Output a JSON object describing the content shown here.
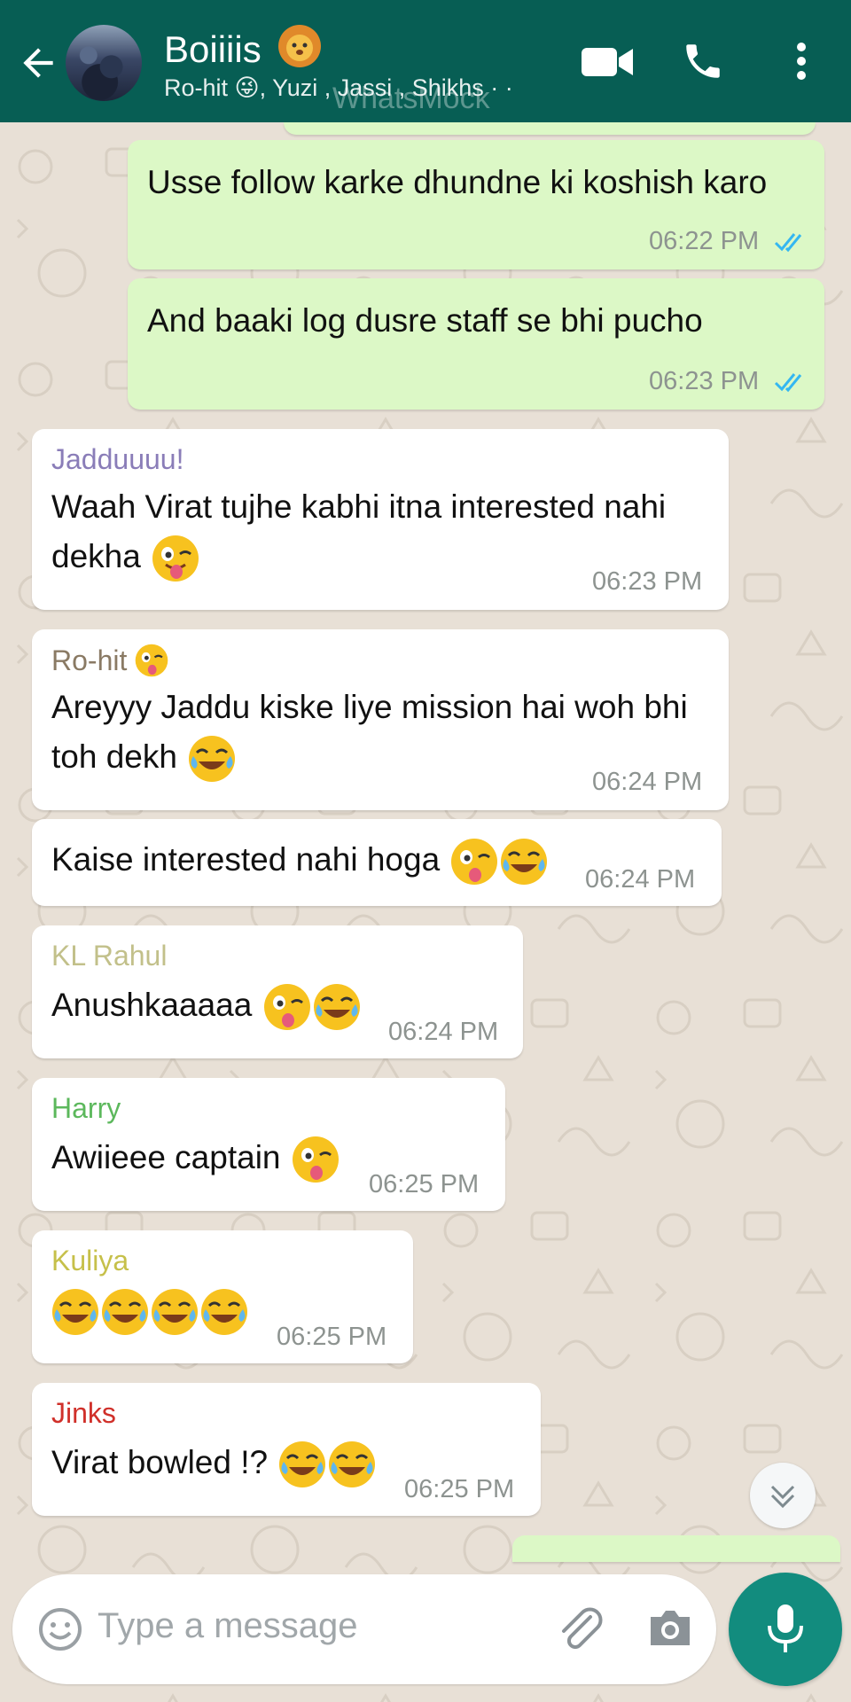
{
  "header": {
    "title": "Boiiiis",
    "subtitle": "Ro-hit 😜, Yuzi , Jassi , Shikhs · ·",
    "watermark": "WhatsMock"
  },
  "colors": {
    "header_bg": "#075e54",
    "outgoing_bubble": "#dcf8c6",
    "incoming_bubble": "#ffffff",
    "chat_bg": "#e8e0d6",
    "read_ticks": "#34b7f1",
    "fab": "#128c7e"
  },
  "messages": [
    {
      "direction": "out",
      "text": "Usse follow karke dhundne ki koshish karo",
      "time": "06:22 PM",
      "status": "read"
    },
    {
      "direction": "out",
      "text": "And baaki log dusre staff se bhi pucho",
      "time": "06:23 PM",
      "status": "read"
    },
    {
      "direction": "in",
      "sender": "Jadduuuu!",
      "sender_color": "#8a7db8",
      "line1": "Waah Virat tujhe kabhi itna interested nahi",
      "line2": "dekha",
      "emojis": [
        "winking-tongue"
      ],
      "time": "06:23 PM"
    },
    {
      "direction": "in",
      "sender": "Ro-hit",
      "sender_color": "#8a7a64",
      "sender_emoji": "winking-tongue",
      "line1": "Areyyy Jaddu kiske liye mission hai woh bhi",
      "line2": "toh dekh",
      "emojis": [
        "tears-of-joy"
      ],
      "time": "06:24 PM"
    },
    {
      "direction": "in",
      "text": "Kaise interested nahi hoga",
      "emojis": [
        "winking-tongue",
        "tears-of-joy"
      ],
      "time": "06:24 PM"
    },
    {
      "direction": "in",
      "sender": "KL Rahul",
      "sender_color": "#c2c08a",
      "text": "Anushkaaaaa",
      "emojis": [
        "winking-tongue",
        "tears-of-joy"
      ],
      "time": "06:24 PM"
    },
    {
      "direction": "in",
      "sender": "Harry",
      "sender_color": "#5cb85c",
      "text": "Awiieee captain",
      "emojis": [
        "winking-tongue"
      ],
      "time": "06:25 PM"
    },
    {
      "direction": "in",
      "sender": "Kuliya",
      "sender_color": "#c6c04a",
      "text": "",
      "emojis": [
        "tears-of-joy",
        "tears-of-joy",
        "tears-of-joy",
        "tears-of-joy"
      ],
      "time": "06:25 PM"
    },
    {
      "direction": "in",
      "sender": "Jinks",
      "sender_color": "#d0302a",
      "text": "Virat bowled !?",
      "emojis": [
        "tears-of-joy",
        "tears-of-joy"
      ],
      "time": "06:25 PM"
    }
  ],
  "composer": {
    "placeholder": "Type a message"
  },
  "icons": [
    "back-arrow-icon",
    "video-call-icon",
    "phone-icon",
    "more-vert-icon",
    "emoji-icon",
    "attach-icon",
    "camera-icon",
    "mic-icon",
    "chevron-double-down-icon"
  ]
}
